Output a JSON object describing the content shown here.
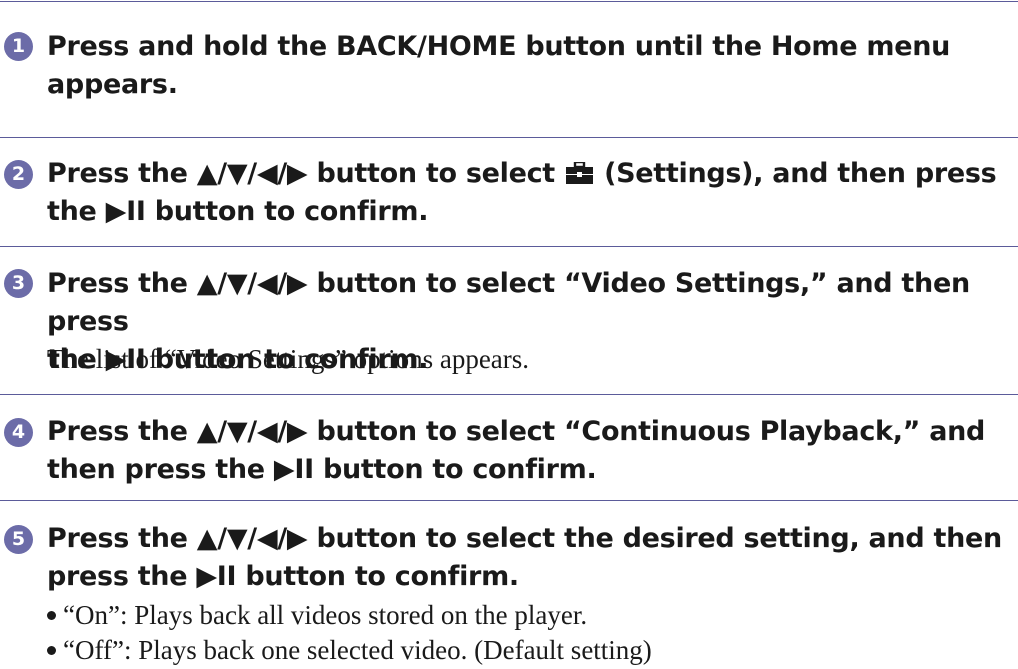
{
  "steps": [
    {
      "number": "1",
      "lines": [
        "Press and hold the BACK/HOME button until the Home menu",
        "appears."
      ]
    },
    {
      "number": "2",
      "line1_before_icon": "Press the ▲/▼/◀/▶ button to select ",
      "line1_after_icon": " (Settings), and then press",
      "line2": "the ▶II button to confirm.",
      "icon": "settings-toolbox-icon"
    },
    {
      "number": "3",
      "lines": [
        "Press the ▲/▼/◀/▶ button to select “Video Settings,” and then press",
        "the ▶II button to confirm."
      ],
      "body": "The list of “Video Settings” options appears."
    },
    {
      "number": "4",
      "lines": [
        "Press the ▲/▼/◀/▶ button to select “Continuous Playback,” and",
        "then press the ▶II button to confirm."
      ]
    },
    {
      "number": "5",
      "lines": [
        "Press the ▲/▼/◀/▶ button to select the desired setting, and then",
        "press the ▶II button to confirm."
      ],
      "bullets": [
        "“On”: Plays back all videos stored on the player.",
        "“Off”: Plays back one selected video. (Default setting)"
      ]
    }
  ]
}
